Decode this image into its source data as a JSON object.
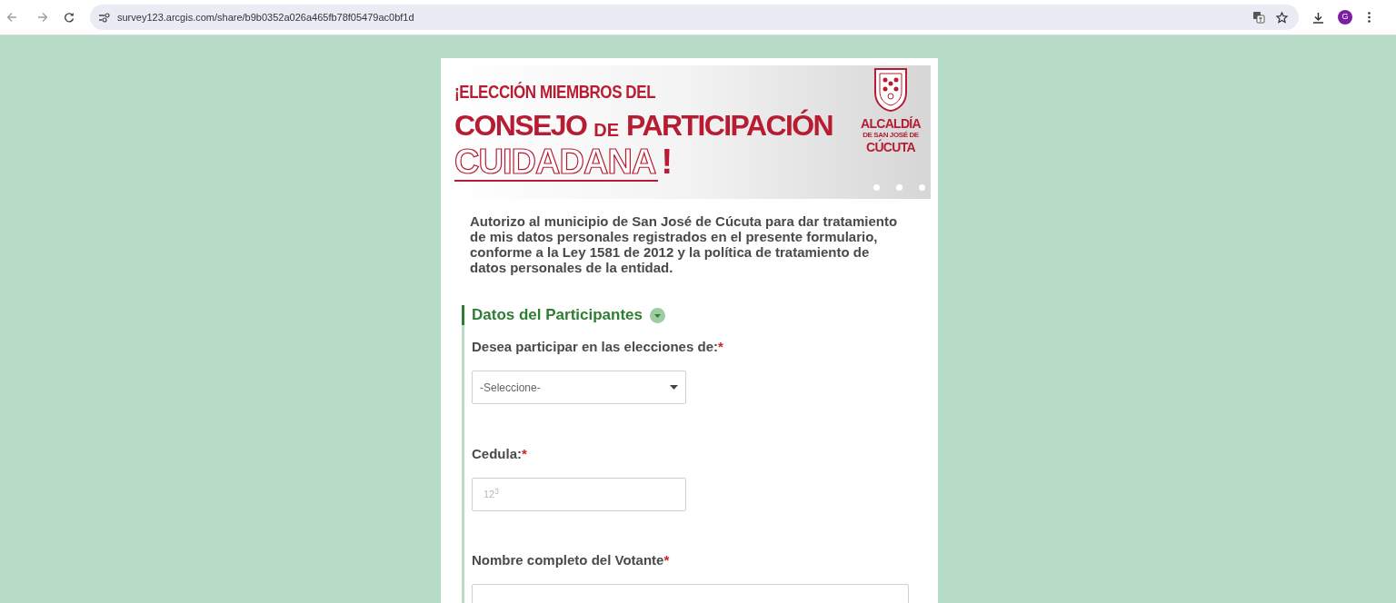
{
  "browser": {
    "url": "survey123.arcgis.com/share/b9b0352a026a465fb78f05479ac0bf1d",
    "profile_initial": "G"
  },
  "banner": {
    "line_1": "¡ELECCIÓN MIEMBROS DEL",
    "line_2a": "CONSEJO",
    "line_2b": "DE",
    "line_2c": "PARTICIPACIÓN",
    "line_3": "CUIDADANA",
    "line_3_mark": "!",
    "logo_lines": [
      "ALCALDÍA",
      "DE SAN JOSÉ DE",
      "CÚCUTA"
    ]
  },
  "consent_text": "Autorizo al municipio de San José de Cúcuta para dar tratamiento de mis datos personales registrados en el presente formulario, conforme a la Ley 1581 de 2012 y la política de tratamiento de datos personales de la entidad.",
  "section": {
    "title": "Datos del Participantes",
    "expanded": true,
    "questions": [
      {
        "kind": "select",
        "label": "Desea participar en las elecciones de:",
        "required_mark": "*",
        "placeholder": "-Seleccione-"
      },
      {
        "kind": "number",
        "label": "Cedula:",
        "required_mark": "*",
        "hint": "12$^{3}$"
      },
      {
        "kind": "text",
        "label": "Nombre completo del Votante",
        "required_mark": "*"
      }
    ]
  }
}
